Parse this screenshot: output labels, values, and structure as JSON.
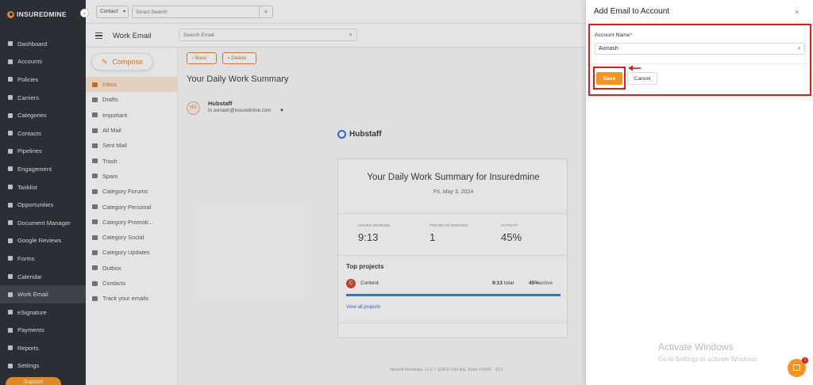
{
  "sidebar": {
    "logo_text": "INSUREDMINE",
    "collapse_icon": "‹",
    "items": [
      {
        "label": "Dashboard",
        "icon": "grid-icon"
      },
      {
        "label": "Accounts",
        "icon": "users-icon"
      },
      {
        "label": "Policies",
        "icon": "doc-icon"
      },
      {
        "label": "Carriers",
        "icon": "truck-icon"
      },
      {
        "label": "Categories",
        "icon": "tag-icon"
      },
      {
        "label": "Contacts",
        "icon": "contact-icon"
      },
      {
        "label": "Pipelines",
        "icon": "filter-icon"
      },
      {
        "label": "Engagement",
        "icon": "megaphone-icon"
      },
      {
        "label": "Tasklist",
        "icon": "list-icon"
      },
      {
        "label": "Opportunities",
        "icon": "chart-icon"
      },
      {
        "label": "Document Manager",
        "icon": "folder-icon"
      },
      {
        "label": "Google Reviews",
        "icon": "google-icon"
      },
      {
        "label": "Forms",
        "icon": "form-icon"
      },
      {
        "label": "Calendar",
        "icon": "calendar-icon"
      },
      {
        "label": "Work Email",
        "icon": "mail-icon"
      },
      {
        "label": "eSignature",
        "icon": "signature-icon"
      },
      {
        "label": "Payments",
        "icon": "dollar-icon"
      },
      {
        "label": "Reports",
        "icon": "report-icon"
      },
      {
        "label": "Settings",
        "icon": "gear-icon"
      }
    ],
    "active_index": 14,
    "support_label": "Support"
  },
  "topbar": {
    "context_select": "Contact",
    "smart_search_placeholder": "Smart Search"
  },
  "mail": {
    "title": "Work Email",
    "search_placeholder": "Search Email",
    "compose_label": "Compose",
    "folders": [
      "Inbox",
      "Drafts",
      "Important",
      "All Mail",
      "Sent Mail",
      "Trash",
      "Spam",
      "Category Forums",
      "Category Personal",
      "Category Promoti...",
      "Category Social",
      "Category Updates",
      "Outbox",
      "Contacts",
      "Track your emails"
    ],
    "active_folder": 0,
    "back_label": "Back",
    "delete_label": "Delete"
  },
  "email": {
    "subject": "Your Daily Work Summary",
    "sender_initials": "HU",
    "sender_name": "Hubstaff",
    "sender_to": "to avinash@insuredmine.com",
    "brand": "Hubstaff",
    "card_title": "Your Daily Work Summary for Insuredmine",
    "card_date": "Fri, May 3, 2024",
    "stats": [
      {
        "label": "HOURS WORKED",
        "value": "9:13"
      },
      {
        "label": "PROJECTS WORKED",
        "value": "1"
      },
      {
        "label": "ACTIVITY",
        "value": "45%"
      }
    ],
    "top_projects_title": "Top projects",
    "project": {
      "initial": "C",
      "name": "Content",
      "time": "9:13",
      "time_suffix": "total",
      "activity": "45%",
      "activity_suffix": "active"
    },
    "view_all": "View all projects",
    "footer": "Netsoft Holdings, LLC • 11800 Olio Rd, Suite #1000 - 313"
  },
  "drawer": {
    "title": "Add Email to Account",
    "close_icon": "×",
    "field_label": "Account Name",
    "required_mark": "*",
    "account_value": "Avinash",
    "save_label": "Save",
    "cancel_label": "Cancel"
  },
  "watermark": {
    "line1": "Activate Windows",
    "line2": "Go to Settings to activate Windows."
  },
  "chat_badge": "1",
  "colors": {
    "accent": "#f7931e",
    "sidebar_bg": "#22282f",
    "annotation_red": "#e21b1b",
    "link_blue": "#2a6be4"
  }
}
